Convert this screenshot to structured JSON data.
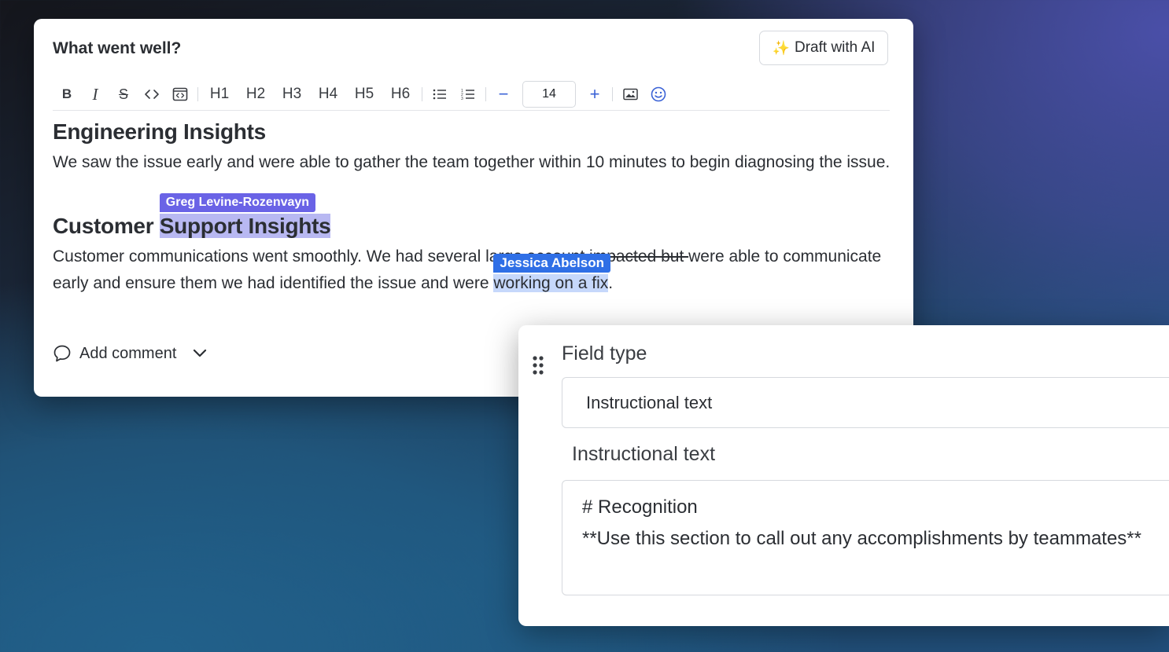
{
  "editor": {
    "title": "What went well?",
    "draft_button": "Draft with AI",
    "toolbar": {
      "headings": [
        "H1",
        "H2",
        "H3",
        "H4",
        "H5",
        "H6"
      ],
      "decrease": "−",
      "font_size": "14",
      "increase": "+"
    },
    "sections": [
      {
        "heading": "Engineering Insights",
        "body": "We saw the issue early and were able to gather the team together within 10 minutes to begin diagnosing the issue."
      },
      {
        "heading_plain": "Customer ",
        "heading_selected": "Support Insights",
        "body_part1": "Customer communications went smoothly. We had several large account i",
        "body_struck": "mpacted but ",
        "body_part2": "were able to communicate early and ensure them we had identified the issue and were ",
        "body_selected": "working on a fix",
        "body_end": "."
      }
    ],
    "collaborators": {
      "heading_cursor": "Greg Levine-Rozenvayn",
      "body_cursor": "Jessica Abelson"
    },
    "add_comment": "Add comment"
  },
  "field_panel": {
    "field_type_label": "Field type",
    "field_type_value": "Instructional text",
    "instructional_label": "Instructional text",
    "instructional_value": "# Recognition\n**Use this section to call out any accomplishments by teammates**"
  },
  "colors": {
    "greg_cursor": "#6a63e6",
    "jessica_cursor": "#2f6fe6",
    "toolbar_accent": "#3a62d6"
  }
}
